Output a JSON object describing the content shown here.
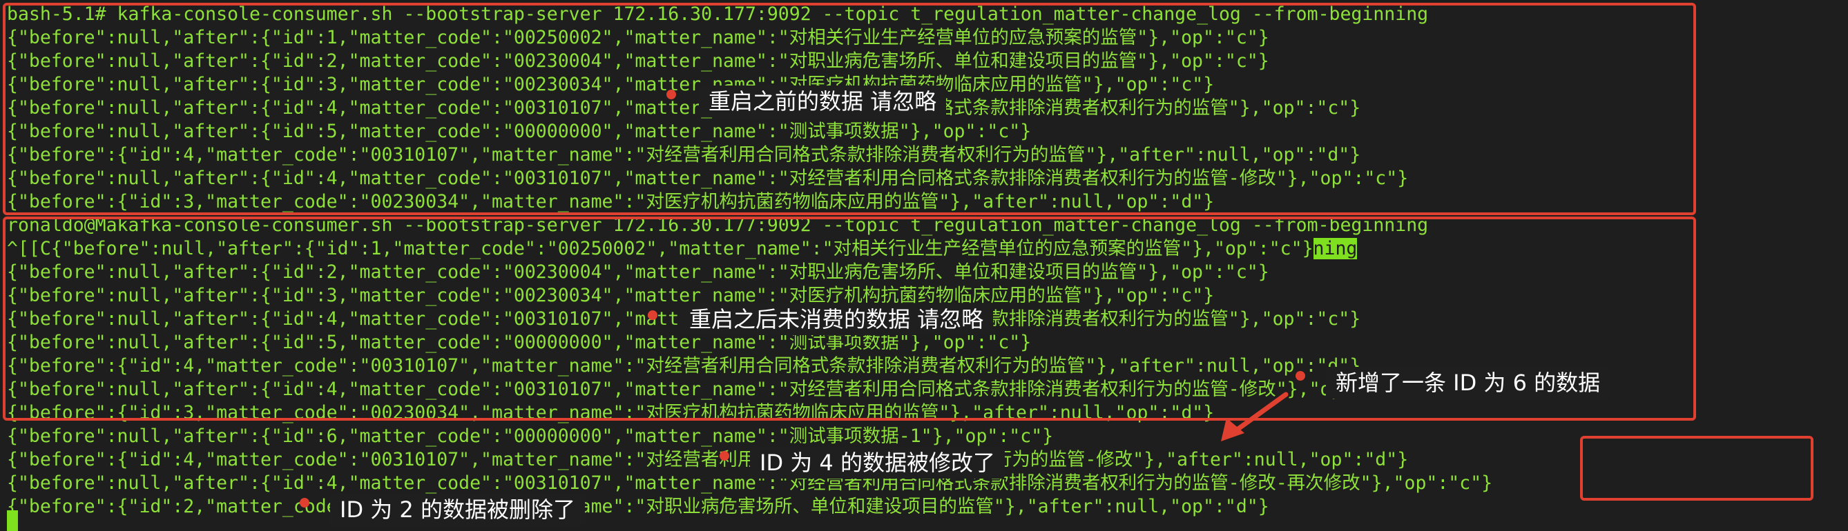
{
  "terminal": {
    "lines": [
      "bash-5.1# kafka-console-consumer.sh --bootstrap-server 172.16.30.177:9092 --topic t_regulation_matter-change_log --from-beginning",
      "{\"before\":null,\"after\":{\"id\":1,\"matter_code\":\"00250002\",\"matter_name\":\"对相关行业生产经营单位的应急预案的监管\"},\"op\":\"c\"}",
      "{\"before\":null,\"after\":{\"id\":2,\"matter_code\":\"00230004\",\"matter_name\":\"对职业病危害场所、单位和建设项目的监管\"},\"op\":\"c\"}",
      "{\"before\":null,\"after\":{\"id\":3,\"matter_code\":\"00230034\",\"matter_name\":\"对医疗机构抗菌药物临床应用的监管\"},\"op\":\"c\"}",
      "{\"before\":null,\"after\":{\"id\":4,\"matter_code\":\"00310107\",\"matter_name\":\"对经营者利用合同格式条款排除消费者权利行为的监管\"},\"op\":\"c\"}",
      "{\"before\":null,\"after\":{\"id\":5,\"matter_code\":\"00000000\",\"matter_name\":\"测试事项数据\"},\"op\":\"c\"}",
      "{\"before\":{\"id\":4,\"matter_code\":\"00310107\",\"matter_name\":\"对经营者利用合同格式条款排除消费者权利行为的监管\"},\"after\":null,\"op\":\"d\"}",
      "{\"before\":null,\"after\":{\"id\":4,\"matter_code\":\"00310107\",\"matter_name\":\"对经营者利用合同格式条款排除消费者权利行为的监管-修改\"},\"op\":\"c\"}",
      "{\"before\":{\"id\":3,\"matter_code\":\"00230034\",\"matter_name\":\"对医疗机构抗菌药物临床应用的监管\"},\"after\":null,\"op\":\"d\"}",
      "ronaldo@Makafka-console-consumer.sh --bootstrap-server 172.16.30.177:9092 --topic t_regulation_matter-change_log --from-beginning",
      "^[[C{\"before\":null,\"after\":{\"id\":1,\"matter_code\":\"00250002\",\"matter_name\":\"对相关行业生产经营单位的应急预案的监管\"},\"op\":\"c\"}",
      "{\"before\":null,\"after\":{\"id\":2,\"matter_code\":\"00230004\",\"matter_name\":\"对职业病危害场所、单位和建设项目的监管\"},\"op\":\"c\"}",
      "{\"before\":null,\"after\":{\"id\":3,\"matter_code\":\"00230034\",\"matter_name\":\"对医疗机构抗菌药物临床应用的监管\"},\"op\":\"c\"}",
      "{\"before\":null,\"after\":{\"id\":4,\"matter_code\":\"00310107\",\"matter_name\":\"对经营者利用合同格式条款排除消费者权利行为的监管\"},\"op\":\"c\"}",
      "{\"before\":null,\"after\":{\"id\":5,\"matter_code\":\"00000000\",\"matter_name\":\"测试事项数据\"},\"op\":\"c\"}",
      "{\"before\":{\"id\":4,\"matter_code\":\"00310107\",\"matter_name\":\"对经营者利用合同格式条款排除消费者权利行为的监管\"},\"after\":null,\"op\":\"d\"}",
      "{\"before\":null,\"after\":{\"id\":4,\"matter_code\":\"00310107\",\"matter_name\":\"对经营者利用合同格式条款排除消费者权利行为的监管-修改\"},\"op\":\"c\"}",
      "{\"before\":{\"id\":3,\"matter_code\":\"00230034\",\"matter_name\":\"对医疗机构抗菌药物临床应用的监管\"},\"after\":null,\"op\":\"d\"}",
      "{\"before\":null,\"after\":{\"id\":6,\"matter_code\":\"00000000\",\"matter_name\":\"测试事项数据-1\"},\"op\":\"c\"}",
      "{\"before\":{\"id\":4,\"matter_code\":\"00310107\",\"matter_name\":\"对经营者利用合同格式条款排除消费者权利行为的监管-修改\"},\"after\":null,\"op\":\"d\"}",
      "{\"before\":null,\"after\":{\"id\":4,\"matter_code\":\"00310107\",\"matter_name\":\"对经营者利用合同格式条款排除消费者权利行为的监管-修改-再次修改\"},\"op\":\"c\"}",
      "{\"before\":{\"id\":2,\"matter_code\":\"00230004\",\"matter_name\":\"对职业病危害场所、单位和建设项目的监管\"},\"after\":null,\"op\":\"d\"}"
    ],
    "highlight_text": "ning"
  },
  "annotations": {
    "before_restart": "重启之前的数据 请忽略",
    "after_restart_unconsumed": "重启之后未消费的数据 请忽略",
    "new_id6": "新增了一条 ID 为 6 的数据",
    "id4_modified": "ID 为 4 的数据被修改了",
    "id2_deleted": "ID 为 2 的数据被删除了"
  },
  "colors": {
    "terminal_text": "#8ee03a",
    "annotation_red": "#e0402f",
    "background": "#1e1e1e"
  }
}
